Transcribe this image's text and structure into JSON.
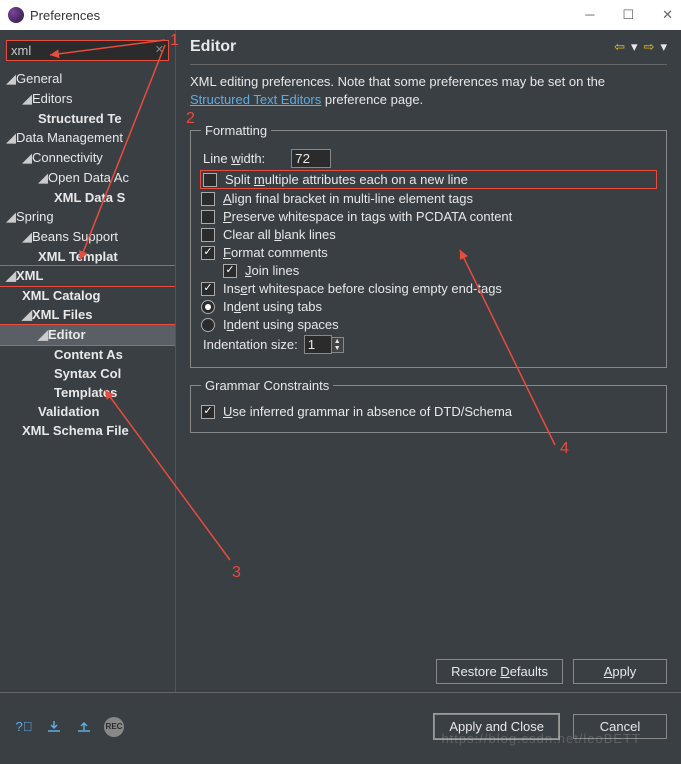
{
  "window": {
    "title": "Preferences"
  },
  "search": {
    "value": "xml"
  },
  "tree": {
    "general": "General",
    "editors": "Editors",
    "structured": "Structured Te",
    "datamgmt": "Data Management",
    "connectivity": "Connectivity",
    "openDataAc": "Open Data Ac",
    "xmlData": "XML Data S",
    "spring": "Spring",
    "beans": "Beans Support",
    "xmlTemplat": "XML Templat",
    "xml": "XML",
    "xmlCatalog": "XML Catalog",
    "xmlFiles": "XML Files",
    "editor": "Editor",
    "contentAs": "Content As",
    "syntaxCol": "Syntax Col",
    "templates": "Templates",
    "validation": "Validation",
    "xmlSchema": "XML Schema File"
  },
  "page": {
    "title": "Editor",
    "intro1": "XML editing preferences.  Note that some preferences may be set on the ",
    "introLink": "Structured Text Editors",
    "intro2": " preference page."
  },
  "formatting": {
    "legend": "Formatting",
    "lineWidthLabel": "Line width:",
    "lineWidth": "72",
    "split": "Split multiple attributes each on a new line",
    "align": "Align final bracket in multi-line element tags",
    "preserve": "Preserve whitespace in tags with PCDATA content",
    "clear": "Clear all blank lines",
    "formatComments": "Format comments",
    "joinLines": "Join lines",
    "insertWs": "Insert whitespace before closing empty end-tags",
    "indentTabs": "Indent using tabs",
    "indentSpaces": "Indent using spaces",
    "indentSizeLabel": "Indentation size:",
    "indentSize": "1"
  },
  "grammar": {
    "legend": "Grammar Constraints",
    "useInferred": "Use inferred grammar in absence of DTD/Schema"
  },
  "buttons": {
    "restore": "Restore Defaults",
    "apply": "Apply",
    "applyClose": "Apply and Close",
    "cancel": "Cancel"
  },
  "annot": {
    "a1": "1",
    "a2": "2",
    "a3": "3",
    "a4": "4"
  },
  "watermark": "https://blog.csdn.net/leoBETT"
}
